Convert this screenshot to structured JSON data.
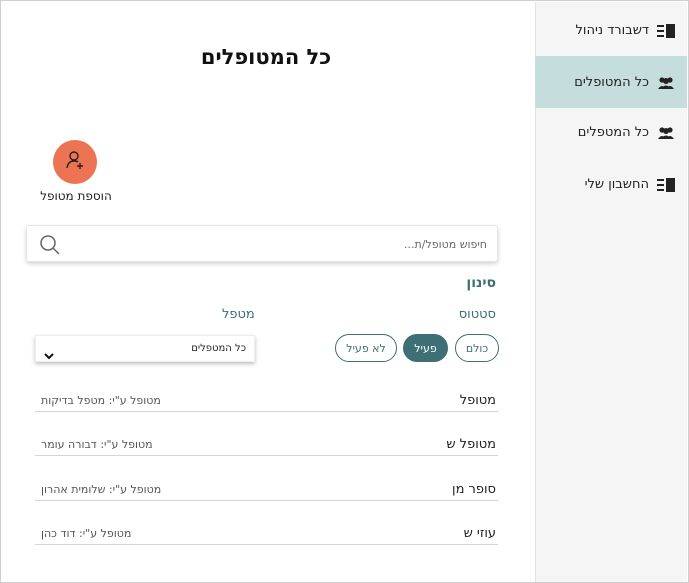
{
  "sidebar": {
    "items": [
      {
        "label": "דשבורד ניהול",
        "icon": "document-list-icon",
        "active": false
      },
      {
        "label": "כל המטופלים",
        "icon": "users-icon",
        "active": true
      },
      {
        "label": "כל המטפלים",
        "icon": "users-icon",
        "active": false
      },
      {
        "label": "החשבון שלי",
        "icon": "document-list-icon",
        "active": false
      }
    ]
  },
  "main": {
    "title": "כל המטופלים",
    "add_patient_label": "הוספת מטופל",
    "search": {
      "placeholder": "חיפוש מטופל/ת..."
    },
    "filter": {
      "title": "סינון",
      "status_label": "סטטוס",
      "therapist_label": "מטפל",
      "status_options": [
        "כולם",
        "פעיל",
        "לא פעיל"
      ],
      "selected_status": "פעיל",
      "therapist_selected": "כל המטפלים"
    },
    "patients": [
      {
        "name": "מטופל",
        "therapist": "מטופל ע\"י: מטפל בדיקות"
      },
      {
        "name": "מטופל ש",
        "therapist": "מטופל ע\"י: דבורה עומר"
      },
      {
        "name": "סופר מן",
        "therapist": "מטופל ע\"י: שלומית אהרון"
      },
      {
        "name": "עוזי ש",
        "therapist": "מטופל ע\"י: דוד כהן"
      }
    ]
  },
  "colors": {
    "accent": "#3d6f75",
    "add_button": "#ec7452",
    "sidebar_active": "#c5dedd",
    "sidebar_bg": "#f5f5f5"
  }
}
